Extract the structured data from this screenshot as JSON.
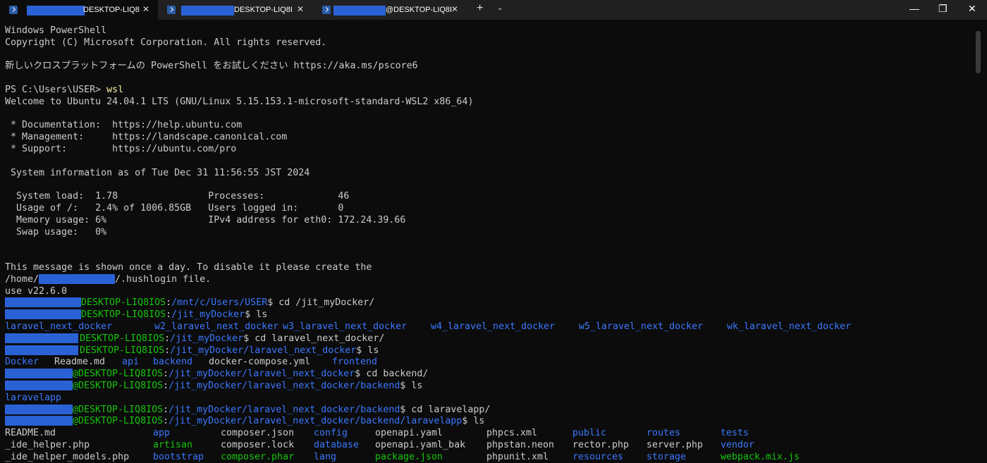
{
  "tabs": [
    {
      "title": "DESKTOP-LIQ8",
      "active": true
    },
    {
      "title": "DESKTOP-LIQ8I",
      "active": false
    },
    {
      "title": "@DESKTOP-LIQ8I",
      "active": false
    }
  ],
  "tab_close_glyph": "✕",
  "new_tab_glyph": "+",
  "dropdown_glyph": "⌄",
  "window_controls": {
    "minimize": "—",
    "maximize": "❐",
    "close": "✕"
  },
  "terminal": {
    "header": [
      "Windows PowerShell",
      "Copyright (C) Microsoft Corporation. All rights reserved.",
      "",
      "新しいクロスプラットフォームの PowerShell をお試しください https://aka.ms/pscore6",
      ""
    ],
    "ps_prompt": "PS C:\\Users\\USER> ",
    "ps_command": "wsl",
    "motd": [
      "Welcome to Ubuntu 24.04.1 LTS (GNU/Linux 5.15.153.1-microsoft-standard-WSL2 x86_64)",
      "",
      " * Documentation:  https://help.ubuntu.com",
      " * Management:     https://landscape.canonical.com",
      " * Support:        https://ubuntu.com/pro",
      "",
      " System information as of Tue Dec 31 11:56:55 JST 2024",
      "",
      "  System load:  1.78                Processes:             46",
      "  Usage of /:   2.4% of 1006.85GB   Users logged in:       0",
      "  Memory usage: 6%                  IPv4 address for eth0: 172.24.39.66",
      "  Swap usage:   0%",
      "",
      "",
      "This message is shown once a day. To disable it please create the"
    ],
    "hushlogin_prefix": "/home/",
    "hushlogin_suffix": "/.hushlogin file.",
    "nvm_line": "use v22.6.0",
    "host": "DESKTOP-LIQ8IOS",
    "host_at": "@DESKTOP-LIQ8IOS",
    "cmds": [
      {
        "path": "/mnt/c/Users/USER",
        "cmd": "cd /jit_myDocker/"
      },
      {
        "path": "/jit_myDocker",
        "cmd": "ls"
      },
      {
        "path": "/jit_myDocker",
        "cmd": "cd laravel_next_docker/"
      },
      {
        "path": "/jit_myDocker/laravel_next_docker",
        "cmd": "ls"
      },
      {
        "path": "/jit_myDocker/laravel_next_docker",
        "cmd": "cd backend/"
      },
      {
        "path": "/jit_myDocker/laravel_next_docker/backend",
        "cmd": "ls"
      },
      {
        "path": "/jit_myDocker/laravel_next_docker/backend",
        "cmd": "cd laravelapp/"
      },
      {
        "path": "/jit_myDocker/laravel_next_docker/backend/laravelapp",
        "cmd": "ls"
      }
    ],
    "prompt_tail": "$ ",
    "ls1": [
      "laravel_next_docker",
      "w2_laravel_next_docker",
      "w3_laravel_next_docker",
      "w4_laravel_next_docker",
      "w5_laravel_next_docker",
      "wk_laravel_next_docker"
    ],
    "ls2": [
      {
        "name": "Docker",
        "kind": "dir"
      },
      {
        "name": "Readme.md",
        "kind": "file"
      },
      {
        "name": "api",
        "kind": "dir"
      },
      {
        "name": "backend",
        "kind": "dir"
      },
      {
        "name": "docker-compose.yml",
        "kind": "file"
      },
      {
        "name": "frontend",
        "kind": "dir"
      }
    ],
    "ls3": [
      "laravelapp"
    ],
    "ls4": [
      [
        {
          "name": "README.md",
          "kind": "file"
        },
        {
          "name": "app",
          "kind": "dir"
        },
        {
          "name": "composer.json",
          "kind": "file"
        },
        {
          "name": "config",
          "kind": "dir"
        },
        {
          "name": "openapi.yaml",
          "kind": "file"
        },
        {
          "name": "phpcs.xml",
          "kind": "file"
        },
        {
          "name": "public",
          "kind": "dir"
        },
        {
          "name": "routes",
          "kind": "dir"
        },
        {
          "name": "tests",
          "kind": "dir"
        }
      ],
      [
        {
          "name": "_ide_helper.php",
          "kind": "file"
        },
        {
          "name": "artisan",
          "kind": "exec"
        },
        {
          "name": "composer.lock",
          "kind": "file"
        },
        {
          "name": "database",
          "kind": "dir"
        },
        {
          "name": "openapi.yaml_bak",
          "kind": "file"
        },
        {
          "name": "phpstan.neon",
          "kind": "file"
        },
        {
          "name": "rector.php",
          "kind": "file"
        },
        {
          "name": "server.php",
          "kind": "file"
        },
        {
          "name": "vendor",
          "kind": "dir"
        }
      ],
      [
        {
          "name": "_ide_helper_models.php",
          "kind": "file"
        },
        {
          "name": "bootstrap",
          "kind": "dir"
        },
        {
          "name": "composer.phar",
          "kind": "exec"
        },
        {
          "name": "lang",
          "kind": "dir"
        },
        {
          "name": "package.json",
          "kind": "exec"
        },
        {
          "name": "phpunit.xml",
          "kind": "file"
        },
        {
          "name": "resources",
          "kind": "dir"
        },
        {
          "name": "storage",
          "kind": "dir"
        },
        {
          "name": "webpack.mix.js",
          "kind": "exec"
        }
      ]
    ],
    "colors": {
      "prompt_host": "#16c60c",
      "path": "#3b78ff",
      "dir": "#3b78ff",
      "exec": "#16c60c",
      "text": "#cccccc",
      "command": "#f9f1a5",
      "redaction": "#2a62d6",
      "background": "#0c0c0c"
    }
  }
}
